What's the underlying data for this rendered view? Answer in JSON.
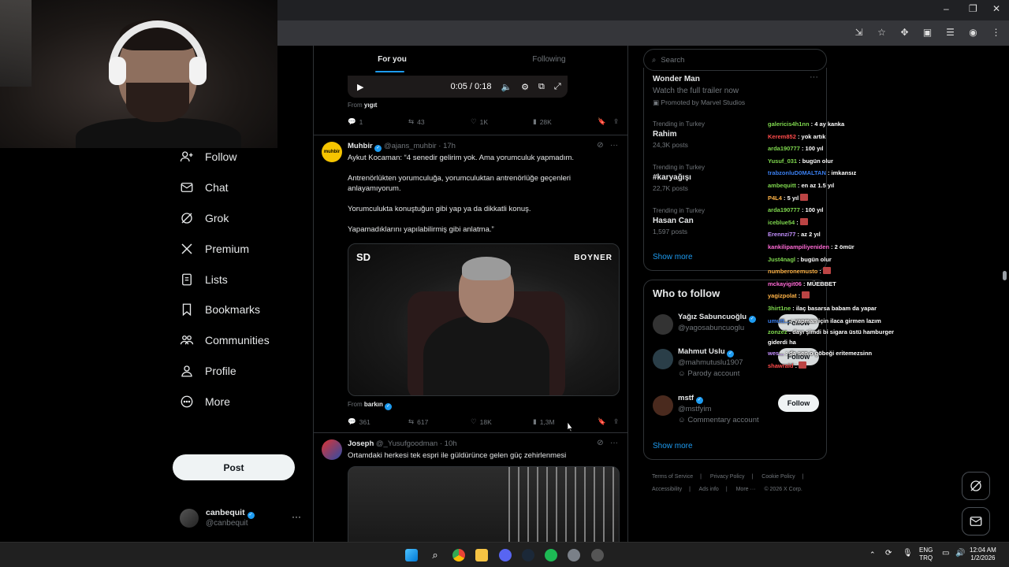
{
  "browser": {
    "window_controls": [
      "–",
      "❐",
      "✕"
    ]
  },
  "tabs": {
    "for_you": "For you",
    "following": "Following"
  },
  "video": {
    "time": "0:05 / 0:18"
  },
  "tweet0": {
    "from_label": "From",
    "from_name": "yıgıt",
    "stats": {
      "replies": "1",
      "reposts": "43",
      "likes": "1K",
      "views": "28K"
    }
  },
  "tweet1": {
    "name": "Muhbir",
    "handle": "@ajans_muhbir",
    "time": "· 17h",
    "avatar_text": "muhbir",
    "paragraphs": [
      "Aykut Kocaman: “4 senedir gelirim yok. Ama yorumculuk yapmadım.",
      "Antrenörlükten yorumculuğa, yorumculuktan antrenörlüğe geçenleri anlayamıyorum.",
      "Yorumculukta konuştuğun gibi yap ya da dikkatli konuş.",
      "Yapamadıklarını yapılabilirmiş gibi anlatma.”"
    ],
    "media_logo": "SD",
    "media_brand": "BOYNER",
    "from_label": "From",
    "from_name": "barkın",
    "stats": {
      "replies": "361",
      "reposts": "617",
      "likes": "18K",
      "views": "1,3M"
    }
  },
  "tweet2": {
    "name": "Joseph",
    "handle": "@_Yusufgoodman",
    "time": "· 10h",
    "text": "Ortamdaki herkesi tek espri ile güldürünce gelen güç zehirlenmesi"
  },
  "nav": {
    "items": [
      {
        "label": "Follow",
        "icon": "person-add-icon"
      },
      {
        "label": "Chat",
        "icon": "envelope-icon"
      },
      {
        "label": "Grok",
        "icon": "grok-icon"
      },
      {
        "label": "Premium",
        "icon": "x-logo-icon"
      },
      {
        "label": "Lists",
        "icon": "list-icon"
      },
      {
        "label": "Bookmarks",
        "icon": "bookmark-icon"
      },
      {
        "label": "Communities",
        "icon": "communities-icon"
      },
      {
        "label": "Profile",
        "icon": "profile-icon"
      },
      {
        "label": "More",
        "icon": "more-circle-icon"
      }
    ],
    "post": "Post"
  },
  "account": {
    "name": "canbequit",
    "handle": "@canbequit",
    "more": "···"
  },
  "search": {
    "placeholder": "Search"
  },
  "ad": {
    "title": "Wonder Man",
    "subtitle": "Watch the full trailer now",
    "promoted": "Promoted by Marvel Studios",
    "more": "···"
  },
  "trends": [
    {
      "context": "Trending in Turkey",
      "name": "Rahim",
      "posts": "24,3K posts"
    },
    {
      "context": "Trending in Turkey",
      "name": "#karyağışı",
      "posts": "22,7K posts"
    },
    {
      "context": "Trending in Turkey",
      "name": "Hasan Can",
      "posts": "1,597 posts"
    }
  ],
  "show_more": "Show more",
  "who_to_follow": {
    "title": "Who to follow",
    "users": [
      {
        "name": "Yağız Sabuncuoğlu",
        "handle": "@yagosabuncuoglu",
        "label": ""
      },
      {
        "name": "Mahmut Uslu",
        "handle": "@mahmutuslu1907",
        "label": "Parody account"
      },
      {
        "name": "mstf",
        "handle": "@mstfyim",
        "label": "Commentary account"
      }
    ],
    "follow": "Follow",
    "show_more": "Show more"
  },
  "footer": {
    "links": [
      "Terms of Service",
      "|",
      "Privacy Policy",
      "|",
      "Cookie Policy",
      "|",
      "Accessibility",
      "|",
      "Ads info",
      "|",
      "More ···",
      "© 2026 X Corp."
    ]
  },
  "chat": [
    {
      "user": "galericis4h1nn",
      "color": "#7fd84e",
      "text": " : 4 ay kanka"
    },
    {
      "user": "Kerem852",
      "color": "#ff4b4b",
      "text": " : yok artık"
    },
    {
      "user": "arda190777",
      "color": "#7fd84e",
      "text": " : 100 yıl"
    },
    {
      "user": "Yusuf_031",
      "color": "#7fd84e",
      "text": " : bugün olur"
    },
    {
      "user": "trabzonluD0MALTAN",
      "color": "#3a7ff0",
      "text": " : imkansız"
    },
    {
      "user": "ambequitt",
      "color": "#7fd84e",
      "text": " : en az 1.5 yıl"
    },
    {
      "user": "P4L4",
      "color": "#ffb347",
      "text": " : 5 yıl",
      "emote": true
    },
    {
      "user": "arda190777",
      "color": "#7fd84e",
      "text": " : 100 yıl"
    },
    {
      "user": "iceblue54",
      "color": "#7fd84e",
      "text": " :",
      "emote": true
    },
    {
      "user": "Erennzi77",
      "color": "#c490ff",
      "text": " : az 2 yıl"
    },
    {
      "user": "kankilipampiliyeniden",
      "color": "#ff6ad5",
      "text": " : 2 ömür"
    },
    {
      "user": "Just4nagl",
      "color": "#7fd84e",
      "text": " : bugün olur"
    },
    {
      "user": "numberonemusto",
      "color": "#ffb347",
      "text": " :",
      "emote": true
    },
    {
      "user": "mckayigit06",
      "color": "#ff6ad5",
      "text": " : MÜEBBET"
    },
    {
      "user": "yagizpolat",
      "color": "#ffb347",
      "text": " :",
      "emote": true
    },
    {
      "user": "3hirt1ne",
      "color": "#7fd84e",
      "text": " : ilaç basarsa babam da yapar"
    },
    {
      "user": "umutt...",
      "color": "#3a7ff0",
      "text": " : yapman için ilaca girmen lazım"
    },
    {
      "user": "zonzez",
      "color": "#7fd84e",
      "text": " : dayı şimdi bi sigara üstü hamburger giderdi ha"
    },
    {
      "user": "wes...",
      "color": "#c490ff",
      "text": " : da sen o göbeği eritemezsinn"
    },
    {
      "user": "shawraid",
      "color": "#ff4b4b",
      "text": " :",
      "emote": true
    }
  ],
  "taskbar": {
    "lang_line1": "ENG",
    "lang_line2": "TRQ",
    "time": "12:04 AM",
    "date": "1/2/2026"
  }
}
